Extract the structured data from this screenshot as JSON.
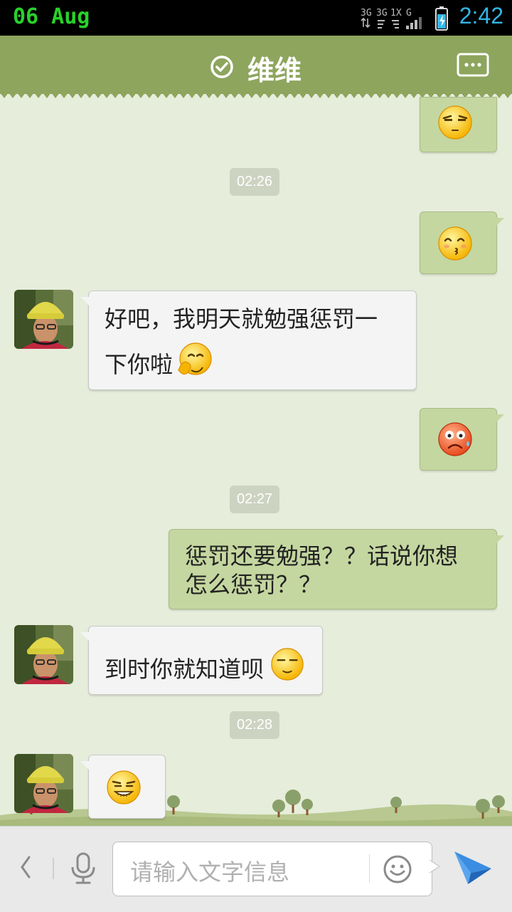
{
  "status_bar": {
    "date": "06 Aug",
    "time": "2:42",
    "network_labels": [
      "3G",
      "3G",
      "1X",
      "G"
    ]
  },
  "header": {
    "title": "维维"
  },
  "messages": {
    "ts1": "02:26",
    "ts2": "02:27",
    "ts3": "02:28",
    "in1_line1": "好吧，我明天就勉强惩罚一",
    "in1_line2": "下你啦",
    "out1_line1": "惩罚还要勉强？？话说你想",
    "out1_line2": "怎么惩罚？？",
    "in2_text": "到时你就知道呗"
  },
  "input": {
    "placeholder": "请输入文字信息"
  },
  "colors": {
    "accent_green": "#8ea55e",
    "background": "#e6eddb",
    "time_blue": "#33b5e5",
    "date_green": "#28d22a",
    "send_blue": "#2f7fd2"
  }
}
